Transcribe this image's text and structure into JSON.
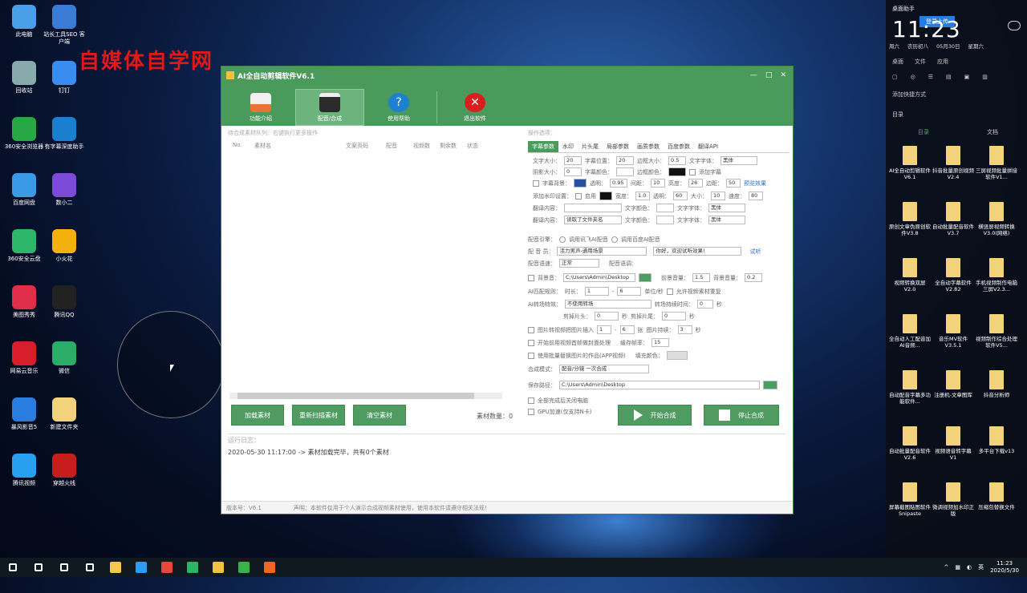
{
  "watermark": "自媒体自学网",
  "desktop_icons": [
    {
      "label": "此电脑",
      "color": "#4aa0e8"
    },
    {
      "label": "站长工具SEO 客户端",
      "color": "#3a7bd5"
    },
    {
      "label": "回收站",
      "color": "#8aa"
    },
    {
      "label": "钉钉",
      "color": "#3a8df0"
    },
    {
      "label": "360安全浏览器",
      "color": "#27a844"
    },
    {
      "label": "有字幕深度助手",
      "color": "#1b7fd0"
    },
    {
      "label": "百度网盘",
      "color": "#3a9ae8"
    },
    {
      "label": "数小二",
      "color": "#7b4ad8"
    },
    {
      "label": "360安全云盘",
      "color": "#2db56a"
    },
    {
      "label": "小火花",
      "color": "#f4b10d"
    },
    {
      "label": "美图秀秀",
      "color": "#e02d4a"
    },
    {
      "label": "腾讯QQ",
      "color": "#222"
    },
    {
      "label": "网易云音乐",
      "color": "#d81e2a"
    },
    {
      "label": "微信",
      "color": "#2aae67"
    },
    {
      "label": "暴风影音5",
      "color": "#2a7de0"
    },
    {
      "label": "新建文件夹",
      "color": "#f2d27a"
    },
    {
      "label": "腾讯视频",
      "color": "#28a0f0"
    },
    {
      "label": "穿越火线",
      "color": "#c81d1d"
    }
  ],
  "app": {
    "title": "AI全自动剪辑软件V6.1",
    "toolbar": [
      {
        "label": "功能介绍",
        "color": "#e8743b"
      },
      {
        "label": "配音/合成",
        "color": "#2b2b2b"
      },
      {
        "label": "使用帮助",
        "color": "#1f7fd0"
      },
      {
        "label": "退出软件",
        "color": "#d81e1e"
      }
    ],
    "queue_title": "待合成素材队列：右键执行更多操作",
    "columns": [
      "No.",
      "素材名",
      "文案页码",
      "配音",
      "视频数",
      "剩余数",
      "状态"
    ],
    "buttons": {
      "load": "加载素材",
      "rescan": "重新扫描素材",
      "clear": "清空素材"
    },
    "material_count": "素材数量：0",
    "options_title": "操作选项：",
    "tabs": [
      "字幕参数",
      "水印",
      "片头尾",
      "局部参数",
      "画质参数",
      "百度参数",
      "翻译API"
    ],
    "settings": {
      "font_size_l": "文字大小：",
      "font_size": "20",
      "pos_l": "字幕位置：",
      "pos": "20",
      "border_l": "边框大小：",
      "border": "0.5",
      "font_l": "文字字体：",
      "font": "黑体",
      "shadow_l": "阴影大小：",
      "shadow": "0",
      "color_l": "字幕颜色：",
      "bordercolor_l": "边框颜色：",
      "cb1": "添加字幕",
      "cb_sub": "字幕背景：",
      "trans_l": "透明：",
      "trans": "0.95",
      "space_l": "间距：",
      "space": "10",
      "height_l": "高度：",
      "height": "26",
      "wspace_l": "边距：",
      "wspace": "50",
      "preview": "预览效果",
      "wm_l": "添加水印设置：",
      "wm_cb": "启用",
      "w_l": "宽度：",
      "w": "1.0",
      "alpha_l": "透明：",
      "alpha": "60",
      "size_l": "大小：",
      "size": "10",
      "speed_l": "速度：",
      "speed": "80",
      "tr1_l": "翻译内容：",
      "tr_color_l": "文字颜色：",
      "tr_font_l": "文字字体：",
      "tr_font": "黑体",
      "tr2_l": "翻译内容：",
      "tr2": "读取了文件夹名",
      "tr2_color_l": "文字颜色：",
      "tr2_font_l": "文字字体：",
      "tr2_font": "黑体"
    },
    "voice_engine_l": "配音引擎：",
    "voice_engine_a": "调用讯飞AI配音",
    "voice_engine_b": "调用百度AI配音",
    "voice_l": "配 音 员：",
    "voice": "活力男声-通用场景",
    "voice_text": "你好，欢迎试听效果!",
    "audition": "试听",
    "speed_l": "配音语速：",
    "speed": "正常",
    "tone_l": "配音语调：",
    "bgm_l": "背景音：",
    "bgm_path": "C:\\Users\\Admin\\Desktop",
    "bgm_vol_l": "前景音量：",
    "bgm_vol": "1.5",
    "back_vol_l": "背景音量：",
    "back_vol": "0.2",
    "ai_l": "AI匹配规则：",
    "dur_l": "时长：",
    "dur": "1",
    "dur2": "6",
    "sec_l": "单位/秒",
    "cb_ai": "允许视频素材重复",
    "trans_l": "AI转场特效：",
    "trans_v": "不使用转场",
    "trans_time_l": "转场持续时间：",
    "trans_time": "0",
    "sec2": "秒",
    "cut_start_l": "剪掉片头：",
    "cut_start": "0",
    "cut_end_l": "剪掉片尾：",
    "cut_end": "0",
    "sec3": "秒",
    "cb_pic": "图片转视频把图片插入",
    "pic_a": "1",
    "pic_b": "6",
    "pic_c_l": "张",
    "pic_d_l": "图片持续：",
    "pic_d": "3",
    "sec4": "秒",
    "cb_front": "开始前用视频首帧做封面处理",
    "cover_l": "缓存帧率：",
    "cover": "15",
    "cb_ps": "使用批量替换图片的作品(APP视频)",
    "fill_l": "填充颜色：",
    "compose_l": "合成模式：",
    "compose": "配音/分镜 一次合成",
    "save_l": "保存路径：",
    "save_path": "C:\\Users\\Admin\\Desktop",
    "cb_all": "全部完成后关闭电脑",
    "cb_gpu": "GPU加速(仅支持N卡)",
    "start": "开始合成",
    "stop": "停止合成",
    "log_title": "运行日志：",
    "log_line": "2020-05-30 11:17:00 -> 素材加载完毕，共有0个素材",
    "version": "版本号：V6.1",
    "notice": "声明：本软件仅用于个人演示合成视频素材使用，使用本软件请遵守相关法规！"
  },
  "right_panel": {
    "header": "桌面助手",
    "cloud_btn": "登录上传",
    "clock": "11:23",
    "sub": [
      "周六",
      "农历初八",
      "05月30日",
      "星期六"
    ],
    "row1": [
      "桌面",
      "文件",
      "应用"
    ],
    "add": "添加快捷方式",
    "dir_l": "目录",
    "col_a": "目录",
    "col_b": "文档",
    "files": [
      "AI全自动剪辑软件V6.1",
      "抖音批量原创视频V2.4",
      "三屏视频批量拼接软件V1...",
      "原创文章伪原创软件V3.8",
      "自动批量配音软件V3.7",
      "横竖屏视频转换V3.0(网络)",
      "视频转换双屏V2.0",
      "全自动字幕软件V2.82",
      "手机视频制作电脑三屏V2.3...",
      "全自动人工配音加AI音频...",
      "音乐MV软件V3.5.1",
      "视频制作综合处理软件V5...",
      "自动配音字幕多功能软件...",
      "注册机-文章图库",
      "抖音分析师",
      "自动批量配音软件V2.6",
      "视频语音转字幕V1",
      "多平台下载v13",
      "屏幕截图贴图软件Snipaste",
      "微调视频加水印正版",
      "压缩包替换文件"
    ]
  },
  "taskbar": {
    "time": "11:23",
    "date": "2020/5/30",
    "apps": [
      {
        "name": "windows-start",
        "color": "#fff"
      },
      {
        "name": "search",
        "color": "#fff"
      },
      {
        "name": "cortana",
        "color": "#fff"
      },
      {
        "name": "task-view",
        "color": "#fff"
      },
      {
        "name": "file-explorer",
        "color": "#f2c94c"
      },
      {
        "name": "qq-browser",
        "color": "#2a9df4"
      },
      {
        "name": "chrome",
        "color": "#e8463b"
      },
      {
        "name": "360-browser",
        "color": "#2db56a"
      },
      {
        "name": "ai-editor",
        "color": "#f3c33d"
      },
      {
        "name": "camtasia",
        "color": "#3cb34a"
      },
      {
        "name": "recorder",
        "color": "#f26522"
      }
    ]
  }
}
